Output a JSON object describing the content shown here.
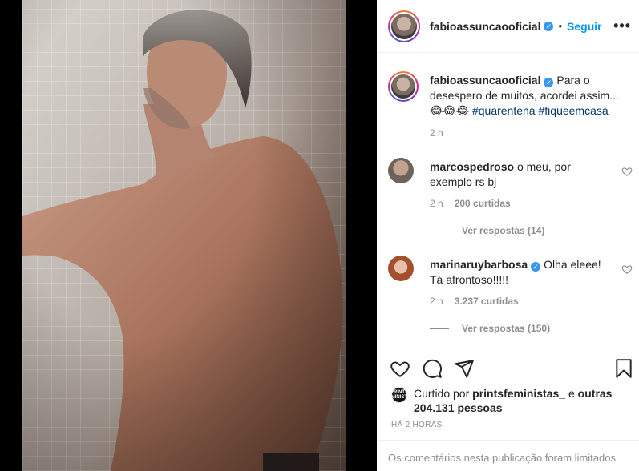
{
  "post": {
    "username": "fabioassuncaooficial",
    "verified_glyph": "✓",
    "separator": "•",
    "follow_label": "Seguir",
    "more_label": "•••",
    "caption_text": "Para o desespero de muitos, acordei assim... 😂😂😂",
    "hashtags": [
      "#quarentena",
      "#fiqueemcasa"
    ],
    "caption_time": "2 h"
  },
  "comments": [
    {
      "username": "marcospedroso",
      "verified": false,
      "text": "o meu, por exemplo rs bj",
      "time": "2 h",
      "likes": "200 curtidas",
      "replies": "Ver respostas (14)"
    },
    {
      "username": "marinaruybarbosa",
      "verified": true,
      "text": "Olha eleee! Tá afrontoso!!!!!",
      "time": "2 h",
      "likes": "3.237 curtidas",
      "replies": "Ver respostas (150)"
    }
  ],
  "actions": {
    "like_icon": "heart-icon",
    "comment_icon": "comment-icon",
    "share_icon": "paper-plane-icon",
    "save_icon": "bookmark-icon",
    "liked_by_prefix": "Curtido por",
    "liked_by_user": "printsfeministas_",
    "liked_by_suffix": "e",
    "liked_by_others": "outras 204.131 pessoas",
    "liked_avatar_text": "PRINTS FEMINISTAS",
    "posted_time": "HÁ 2 HORAS",
    "comments_limited": "Os comentários nesta publicação foram limitados."
  },
  "colors": {
    "accent": "#0095f6",
    "verified": "#3897f0",
    "hashtag": "#00376b",
    "muted": "#8e8e8e",
    "text": "#262626"
  }
}
